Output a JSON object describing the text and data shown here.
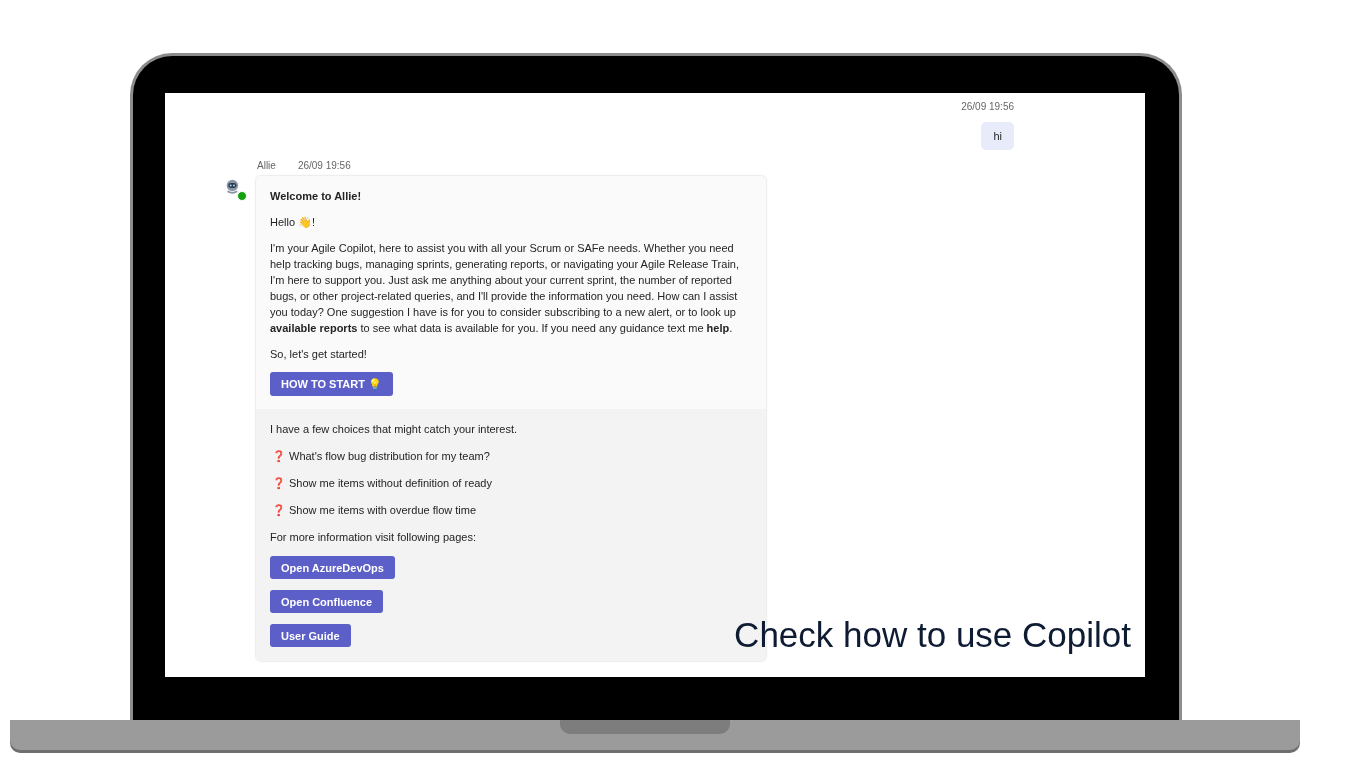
{
  "caption": "Check how to use Copilot",
  "messages": [
    {
      "kind": "user",
      "time": "26/09 19:56",
      "text": "hi"
    },
    {
      "kind": "bot",
      "sender": "Allie",
      "time": "26/09 19:56",
      "online": true,
      "title": "Welcome to Allie!",
      "paragraphs": [
        "Hello 👋!",
        "I'm your Agile Copilot, here to assist you with all your Scrum or SAFe needs. Whether you need help tracking bugs, managing sprints, generating reports, or navigating your Agile Release Train, I'm here to support you. Just ask me anything about your current sprint, the number of reported bugs, or other project-related queries, and I'll provide the information you need. How can I assist you today? One suggestion I have is for you to consider subscribing to a new alert, or to look up **available reports** to see what data is available for you. If you need any guidance text me **help**.",
        "So, let's get started!"
      ],
      "action": "HOW TO START 💡",
      "intro": "I have a few choices that might catch your interest.",
      "suggestions": [
        {
          "icon": "❓",
          "text": "What's flow bug distribution for my team?"
        },
        {
          "icon": "❓",
          "text": "Show me items without definition of ready"
        },
        {
          "icon": "❓",
          "text": "Show me items with overdue flow time"
        }
      ],
      "links_intro": "For more information visit following pages:",
      "links": [
        "Open AzureDevOps",
        "Open Confluence",
        "User Guide"
      ]
    }
  ]
}
